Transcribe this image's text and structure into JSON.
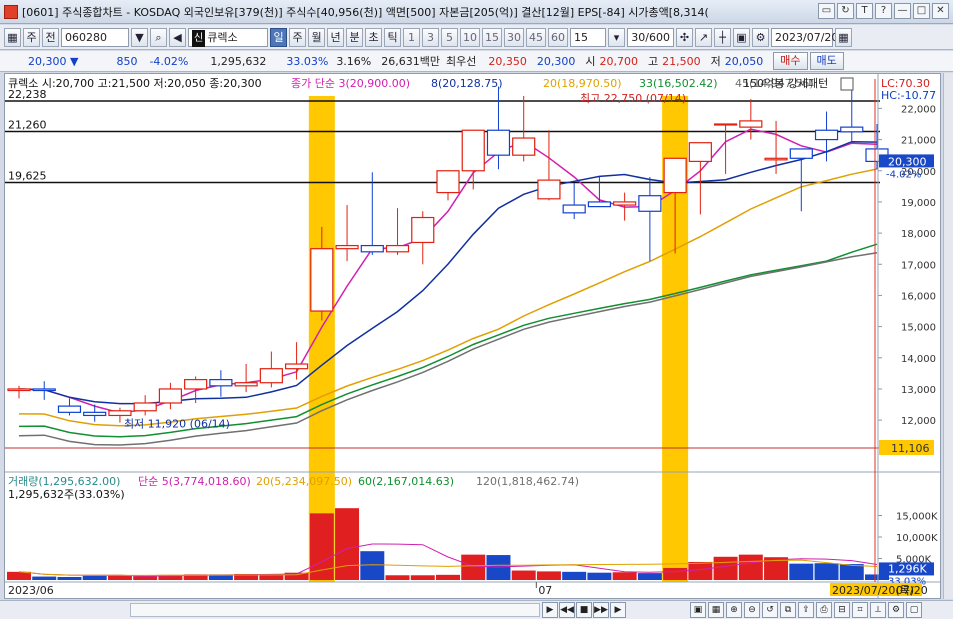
{
  "window": {
    "title": "[0601] 주식종합차트 - KOSDAQ 외국인보유[379(천)] 주식수[40,956(천)] 액면[500] 자본금[205(억)] 결산[12월] EPS[-84] 시가총액[8,314(",
    "buttons": [
      "▭",
      "↻",
      "T",
      "?",
      "—",
      "□",
      "✕"
    ]
  },
  "toolbar": {
    "item1": "주",
    "item2": "전",
    "code": "060280",
    "tag": "신",
    "stock_name": "큐렉소",
    "periods": [
      "일",
      "주",
      "월",
      "년",
      "분",
      "초",
      "틱"
    ],
    "selected_period": "일",
    "numbers": [
      "1",
      "3",
      "5",
      "10",
      "15",
      "30",
      "45",
      "60"
    ],
    "select_value": "15",
    "count": "30/600",
    "date": "2023/07/20"
  },
  "infobar": {
    "price": "20,300 ▼",
    "change": "850",
    "change_pct": "-4.02%",
    "volume": "1,295,632",
    "vol_ratio": "33.03%",
    "turnover": "3.16%",
    "amount": "26,631백만",
    "best_bid_label": "최우선",
    "best_bid": "20,350",
    "best_ask": "20,300",
    "open_label": "시",
    "open": "20,700",
    "high_label": "고",
    "high": "21,500",
    "low_label": "저",
    "low": "20,050",
    "buy": "매수",
    "sell": "매도"
  },
  "price_panel": {
    "ohlc_label": "큐렉소 시:20,700 고:21,500 저:20,050 종:20,300",
    "ma_legend": [
      {
        "label": "종가 단순 3(20,900.00)",
        "color": "#d020b0"
      },
      {
        "label": "8(20,128.75)",
        "color": "#1030a0"
      },
      {
        "label": "20(18,970.50)",
        "color": "#e0a000"
      },
      {
        "label": "33(16,502.42)",
        "color": "#109030"
      },
      {
        "label": "45(14,947.56)",
        "color": "#707070"
      }
    ],
    "pattern_label": "150억봉 강세패턴",
    "lc": "LC:70.30",
    "hc": "HC:-10.77",
    "hlines": [
      "22,238",
      "21,260",
      "19,625"
    ],
    "last_price": "20,300",
    "last_pct": "-4.02%",
    "max_label": "최고 22,750 (07/14)",
    "min_label": "최저 11,920 (06/14)",
    "bottom_level": "11,106",
    "y_ticks": [
      "22,000",
      "21,000",
      "20,000",
      "19,000",
      "18,000",
      "17,000",
      "16,000",
      "15,000",
      "14,000",
      "13,000",
      "12,000"
    ]
  },
  "volume_panel": {
    "legend": [
      {
        "label": "거래량(1,295,632.00)",
        "color": "#2a8a8a"
      },
      {
        "label": "단순 5(3,774,018.60)",
        "color": "#d020b0"
      },
      {
        "label": "20(5,234,097.50)",
        "color": "#e0a000"
      },
      {
        "label": "60(2,167,014.63)",
        "color": "#109030"
      },
      {
        "label": "120(1,818,462.74)",
        "color": "#707070"
      }
    ],
    "sub_label": "1,295,632주(33.03%)",
    "y_ticks": [
      "15,000K",
      "10,000K",
      "5,000K"
    ],
    "current": "1,296K",
    "current_pct": "33.03%"
  },
  "x_axis": {
    "labels": [
      "2023/06",
      "07",
      "07/20"
    ],
    "cursor_date": "2023/07/20(목)"
  },
  "chart_data": {
    "type": "candlestick",
    "dates": [
      "06/01",
      "06/02",
      "06/05",
      "06/07",
      "06/08",
      "06/09",
      "06/12",
      "06/13",
      "06/14",
      "06/15",
      "06/16",
      "06/19",
      "06/20",
      "06/21",
      "06/22",
      "06/23",
      "06/26",
      "06/27",
      "06/28",
      "06/29",
      "06/30",
      "07/03",
      "07/04",
      "07/05",
      "07/06",
      "07/07",
      "07/10",
      "07/11",
      "07/12",
      "07/13",
      "07/14",
      "07/17",
      "07/18",
      "07/19",
      "07/20"
    ],
    "open": [
      12950,
      13000,
      12450,
      12250,
      12150,
      12300,
      12550,
      13000,
      13300,
      13100,
      13200,
      13650,
      15500,
      17500,
      17600,
      17400,
      17700,
      19300,
      20000,
      21300,
      20500,
      19100,
      18900,
      19000,
      18900,
      19200,
      19300,
      20300,
      21500,
      21400,
      20350,
      20700,
      21300,
      21400,
      20700
    ],
    "high": [
      13100,
      13250,
      12700,
      12500,
      12400,
      12800,
      13200,
      13400,
      13600,
      13800,
      14200,
      14500,
      18200,
      18900,
      19950,
      18800,
      18700,
      19500,
      20500,
      22700,
      22400,
      21300,
      19600,
      19800,
      19300,
      19800,
      20400,
      20400,
      21500,
      22300,
      21600,
      20400,
      21900,
      22750,
      21500
    ],
    "low": [
      12700,
      12650,
      12150,
      11950,
      11920,
      12150,
      12350,
      12550,
      12750,
      12900,
      13050,
      13300,
      15200,
      17100,
      17300,
      17300,
      17000,
      19050,
      19400,
      20050,
      20300,
      19050,
      18450,
      18900,
      18400,
      17100,
      17350,
      18600,
      19900,
      21000,
      19900,
      18700,
      20300,
      20900,
      20050
    ],
    "close": [
      13000,
      12950,
      12250,
      12150,
      12300,
      12550,
      13000,
      13300,
      13100,
      13200,
      13650,
      13800,
      17500,
      17600,
      17400,
      17600,
      18500,
      20000,
      21300,
      20500,
      21050,
      19700,
      18650,
      18850,
      19000,
      18700,
      20400,
      20900,
      21500,
      21600,
      20400,
      20400,
      21000,
      21250,
      20300
    ],
    "volume": [
      1900,
      800,
      700,
      1000,
      1100,
      900,
      1200,
      1300,
      1300,
      1400,
      1300,
      1700,
      15500,
      16700,
      6700,
      1100,
      1100,
      1200,
      5900,
      5800,
      2200,
      2000,
      1900,
      1700,
      1800,
      1600,
      2800,
      4200,
      5400,
      5900,
      5300,
      3800,
      3900,
      3700,
      1296
    ],
    "y_range": [
      11106,
      22238
    ],
    "volume_range": [
      0,
      20000
    ],
    "highlight_dates": [
      "06/20",
      "07/10"
    ]
  }
}
